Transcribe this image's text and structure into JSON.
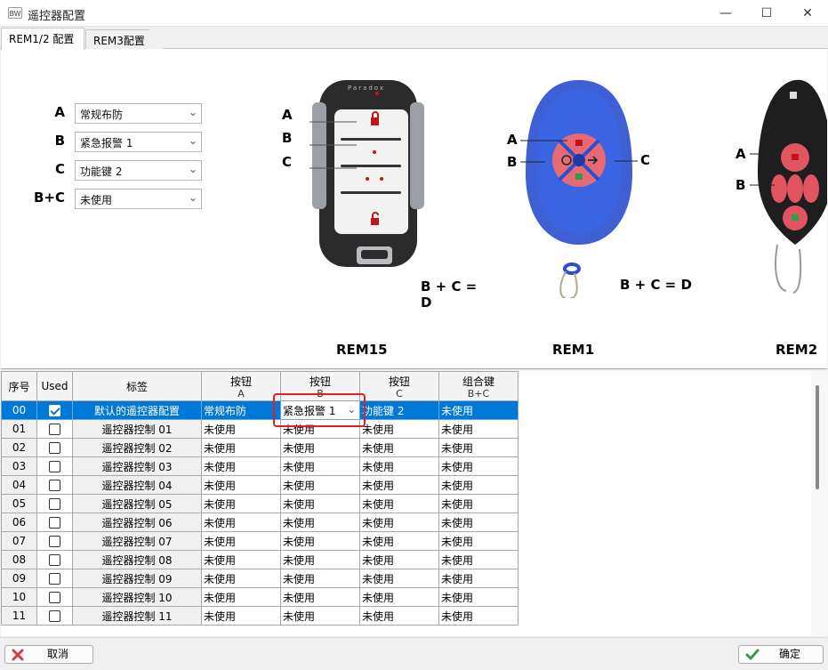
{
  "window": {
    "title": "遥控器配置",
    "icon_text": "BW"
  },
  "tabs": [
    {
      "label": "REM1/2 配置",
      "active": true
    },
    {
      "label": "REM3配置",
      "active": false
    }
  ],
  "config": {
    "rows": [
      {
        "key": "A",
        "value": "常规布防"
      },
      {
        "key": "B",
        "value": "紧急报警 1"
      },
      {
        "key": "C",
        "value": "功能键 2"
      },
      {
        "key": "B+C",
        "value": "未使用"
      }
    ]
  },
  "images": {
    "rem15": {
      "name": "REM15",
      "brand": "Paradox",
      "formula": "B + C = D",
      "callouts": [
        "A",
        "B",
        "C"
      ]
    },
    "rem1": {
      "name": "REM1",
      "formula": "B + C = D",
      "callouts": [
        "A",
        "B",
        "C"
      ]
    },
    "rem2": {
      "name": "REM2",
      "callouts": [
        "A",
        "B"
      ]
    }
  },
  "grid": {
    "headers": {
      "idx": "序号",
      "used": "Used",
      "label": "标签",
      "btn_a_top": "按钮",
      "btn_a_bot": "A",
      "btn_b_top": "按钮",
      "btn_b_bot": "B",
      "btn_c_top": "按钮",
      "btn_c_bot": "C",
      "combo_top": "组合键",
      "combo_bot": "B+C"
    },
    "rows": [
      {
        "idx": "00",
        "used": true,
        "label": "默认的遥控器配置",
        "a": "常规布防",
        "b": "紧急报警 1",
        "c": "功能键 2",
        "bc": "未使用"
      },
      {
        "idx": "01",
        "used": false,
        "label": "遥控器控制 01",
        "a": "未使用",
        "b": "未使用",
        "c": "未使用",
        "bc": "未使用"
      },
      {
        "idx": "02",
        "used": false,
        "label": "遥控器控制 02",
        "a": "未使用",
        "b": "未使用",
        "c": "未使用",
        "bc": "未使用"
      },
      {
        "idx": "03",
        "used": false,
        "label": "遥控器控制 03",
        "a": "未使用",
        "b": "未使用",
        "c": "未使用",
        "bc": "未使用"
      },
      {
        "idx": "04",
        "used": false,
        "label": "遥控器控制 04",
        "a": "未使用",
        "b": "未使用",
        "c": "未使用",
        "bc": "未使用"
      },
      {
        "idx": "05",
        "used": false,
        "label": "遥控器控制 05",
        "a": "未使用",
        "b": "未使用",
        "c": "未使用",
        "bc": "未使用"
      },
      {
        "idx": "06",
        "used": false,
        "label": "遥控器控制 06",
        "a": "未使用",
        "b": "未使用",
        "c": "未使用",
        "bc": "未使用"
      },
      {
        "idx": "07",
        "used": false,
        "label": "遥控器控制 07",
        "a": "未使用",
        "b": "未使用",
        "c": "未使用",
        "bc": "未使用"
      },
      {
        "idx": "08",
        "used": false,
        "label": "遥控器控制 08",
        "a": "未使用",
        "b": "未使用",
        "c": "未使用",
        "bc": "未使用"
      },
      {
        "idx": "09",
        "used": false,
        "label": "遥控器控制 09",
        "a": "未使用",
        "b": "未使用",
        "c": "未使用",
        "bc": "未使用"
      },
      {
        "idx": "10",
        "used": false,
        "label": "遥控器控制 10",
        "a": "未使用",
        "b": "未使用",
        "c": "未使用",
        "bc": "未使用"
      },
      {
        "idx": "11",
        "used": false,
        "label": "遥控器控制 11",
        "a": "未使用",
        "b": "未使用",
        "c": "未使用",
        "bc": "未使用"
      }
    ]
  },
  "footer": {
    "cancel": "取消",
    "ok": "确定"
  },
  "colors": {
    "selection": "#0078d7",
    "highlight": "#e02020",
    "cancel_icon": "#d83b3b",
    "ok_icon": "#2f9e44"
  }
}
